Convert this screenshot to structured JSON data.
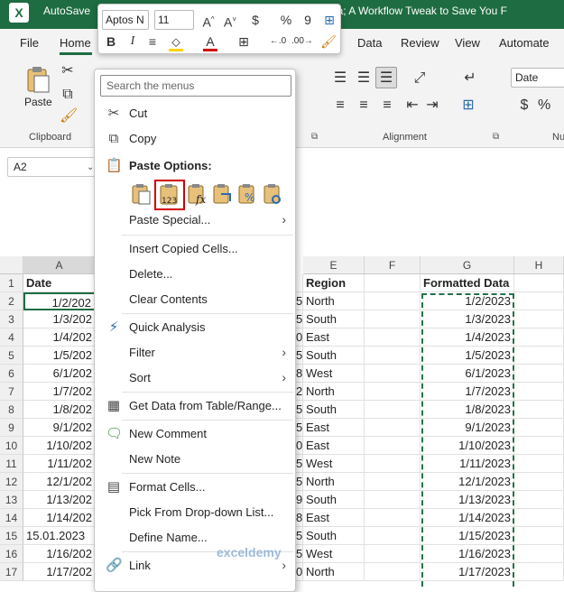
{
  "titlebar": {
    "autosave": "AutoSave",
    "doc_title": "Your Raw Data; A Workflow Tweak to Save You F"
  },
  "tabs": [
    "File",
    "Home",
    "Data",
    "Review",
    "View",
    "Automate"
  ],
  "active_tab": "Home",
  "ribbon": {
    "paste_label": "Paste",
    "clipboard_label": "Clipboard",
    "alignment_label": "Alignment",
    "number_format": "Date",
    "number_label_partial": "Nu"
  },
  "mini_toolbar": {
    "font": "Aptos N",
    "size": "11"
  },
  "name_box": "A2",
  "context_menu": {
    "search_placeholder": "Search the menus",
    "paste_options_header": "Paste Options:",
    "items": {
      "cut": "Cut",
      "copy": "Copy",
      "paste_special": "Paste Special...",
      "insert_copied": "Insert Copied Cells...",
      "delete": "Delete...",
      "clear_contents": "Clear Contents",
      "quick_analysis": "Quick Analysis",
      "filter": "Filter",
      "sort": "Sort",
      "get_data": "Get Data from Table/Range...",
      "new_comment": "New Comment",
      "new_note": "New Note",
      "format_cells": "Format Cells...",
      "pick_dropdown": "Pick From Drop-down List...",
      "define_name": "Define Name...",
      "link": "Link"
    },
    "icons": {
      "cut": "scissors-icon",
      "copy": "copy-icon",
      "paste": "clipboard-icon",
      "quick_analysis": "quick-analysis-icon",
      "get_data": "table-icon",
      "new_comment": "comment-icon",
      "format_cells": "format-cells-icon",
      "link": "link-icon"
    },
    "selected_paste_option": "values-123"
  },
  "grid": {
    "columns": [
      "A",
      "E",
      "F",
      "G",
      "H"
    ],
    "row_numbers": [
      "1",
      "2",
      "3",
      "4",
      "5",
      "6",
      "7",
      "8",
      "9",
      "10",
      "11",
      "12",
      "13",
      "14",
      "15",
      "16",
      "17"
    ],
    "headers": {
      "date": "Date",
      "region": "Region",
      "formatted": "Formatted Data"
    },
    "colA": [
      "1/2/202",
      "1/3/202",
      "1/4/202",
      "1/5/202",
      "6/1/202",
      "1/7/202",
      "1/8/202",
      "9/1/202",
      "1/10/202",
      "1/11/202",
      "12/1/202",
      "1/13/202",
      "1/14/202",
      "15.01.2023",
      "1/16/202",
      "1/17/202"
    ],
    "colD_tail": [
      "5",
      "5",
      "0",
      "5",
      "8",
      "2",
      "5",
      "5",
      "0",
      "5",
      "5",
      "9",
      "8",
      "5",
      "5",
      "0"
    ],
    "colE": [
      "North",
      "South",
      "East",
      "South",
      "West",
      "North",
      "South",
      "East",
      "East",
      "West",
      "North",
      "South",
      "East",
      "South",
      "West",
      "North"
    ],
    "colG": [
      "1/2/2023",
      "1/3/2023",
      "1/4/2023",
      "1/5/2023",
      "6/1/2023",
      "1/7/2023",
      "1/8/2023",
      "9/1/2023",
      "1/10/2023",
      "1/11/2023",
      "12/1/2023",
      "1/13/2023",
      "1/14/2023",
      "1/15/2023",
      "1/16/2023",
      "1/17/2023"
    ]
  },
  "watermark": "exceldemy",
  "accent": "#1e6c41",
  "highlight": "#d00000",
  "marching_ants": "#217346"
}
